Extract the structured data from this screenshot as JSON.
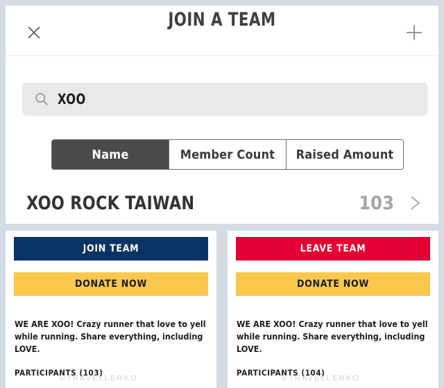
{
  "header": {
    "title": "JOIN A TEAM",
    "close_icon": "close-icon",
    "add_icon": "plus-icon"
  },
  "search": {
    "icon": "search-icon",
    "value": "XOO",
    "placeholder": "Search"
  },
  "sort_tabs": {
    "active_index": 0,
    "items": [
      {
        "label": "Name",
        "active": true
      },
      {
        "label": "Member Count",
        "active": false
      },
      {
        "label": "Raised Amount",
        "active": false
      }
    ]
  },
  "team_list": {
    "rows": [
      {
        "name": "XOO ROCK TAIWAN",
        "count": "103",
        "chevron_icon": "chevron-right-icon"
      }
    ]
  },
  "panels": [
    {
      "primary_action": "JOIN TEAM",
      "donate_action": "DONATE NOW",
      "description": "WE ARE XOO! Crazy runner that love to yell while running. Share everything, including LOVE.",
      "participants": "PARTICIPANTS (103)",
      "primary_color": "#0a3365",
      "donate_color": "#fbc84e"
    },
    {
      "primary_action": "LEAVE TEAM",
      "donate_action": "DONATE NOW",
      "description": "WE ARE XOO! Crazy runner that love to yell while running. Share everything, including LOVE.",
      "participants": "PARTICIPANTS (104)",
      "primary_color": "#e10132",
      "donate_color": "#fbc84e"
    }
  ],
  "watermark": {
    "text": "©TRAVELLERKO"
  },
  "colors": {
    "page_background": "#d5dce4",
    "card_background": "#ffffff",
    "navy": "#0a3365",
    "red": "#e10132",
    "yellow": "#fbc84e",
    "active_tab": "#4a4a4a",
    "title_text": "#3f3f3f",
    "muted_count": "#a6a6a6",
    "search_field": "#e9e9e9"
  }
}
